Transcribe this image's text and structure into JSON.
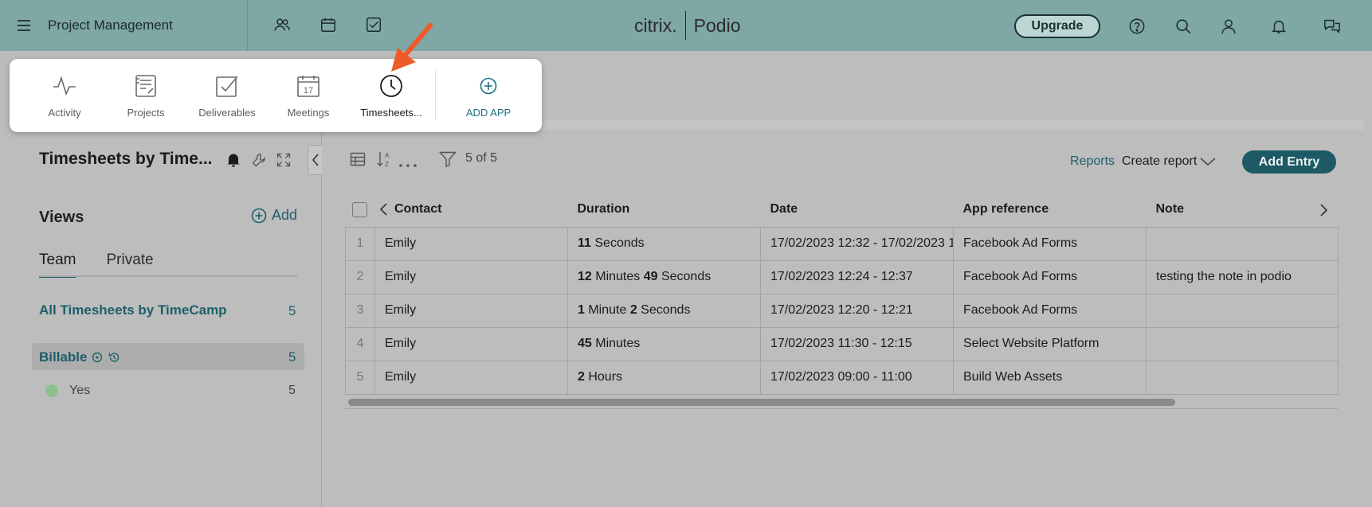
{
  "header": {
    "workspace": "Project Management",
    "brand_citrix": "citrix.",
    "brand_podio": "Podio",
    "upgrade_label": "Upgrade"
  },
  "dropdown": {
    "items": [
      {
        "label": "Activity",
        "icon": "activity-icon"
      },
      {
        "label": "Projects",
        "icon": "projects-icon"
      },
      {
        "label": "Deliverables",
        "icon": "deliverables-icon"
      },
      {
        "label": "Meetings",
        "icon": "meetings-icon",
        "icon_text": "17"
      },
      {
        "label": "Timesheets...",
        "icon": "clock-icon"
      }
    ],
    "add_app_label": "ADD APP"
  },
  "app": {
    "title": "Timesheets by Time..."
  },
  "views": {
    "heading": "Views",
    "add_label": "Add",
    "tabs": [
      "Team",
      "Private"
    ],
    "all_label": "All Timesheets by TimeCamp",
    "all_count": "5",
    "billable_label": "Billable",
    "billable_count": "5",
    "yes_label": "Yes",
    "yes_count": "5"
  },
  "toolbar": {
    "filter_count": "5 of 5",
    "reports_label": "Reports",
    "create_report_label": "Create report",
    "add_entry_label": "Add Entry"
  },
  "table": {
    "columns": [
      "Contact",
      "Duration",
      "Date",
      "App reference",
      "Note"
    ],
    "rows": [
      {
        "num": "1",
        "contact": "Emily",
        "duration": [
          {
            "b": "11"
          },
          {
            "t": " Seconds"
          }
        ],
        "date": "17/02/2023 12:32 - 17/02/2023 1",
        "app_ref": "Facebook Ad Forms",
        "note": ""
      },
      {
        "num": "2",
        "contact": "Emily",
        "duration": [
          {
            "b": "12"
          },
          {
            "t": " Minutes "
          },
          {
            "b": "49"
          },
          {
            "t": " Seconds"
          }
        ],
        "date": "17/02/2023 12:24 - 12:37",
        "app_ref": "Facebook Ad Forms",
        "note": "testing the note in podio"
      },
      {
        "num": "3",
        "contact": "Emily",
        "duration": [
          {
            "b": "1"
          },
          {
            "t": " Minute "
          },
          {
            "b": "2"
          },
          {
            "t": " Seconds"
          }
        ],
        "date": "17/02/2023 12:20 - 12:21",
        "app_ref": "Facebook Ad Forms",
        "note": ""
      },
      {
        "num": "4",
        "contact": "Emily",
        "duration": [
          {
            "b": "45"
          },
          {
            "t": " Minutes"
          }
        ],
        "date": "17/02/2023 11:30 - 12:15",
        "app_ref": "Select Website Platform",
        "note": ""
      },
      {
        "num": "5",
        "contact": "Emily",
        "duration": [
          {
            "b": "2"
          },
          {
            "t": " Hours"
          }
        ],
        "date": "17/02/2023 09:00 - 11:00",
        "app_ref": "Build Web Assets",
        "note": ""
      }
    ]
  },
  "colors": {
    "topbar": "#7ea7a5",
    "accent": "#1d5f6a",
    "arrow": "#f05a28"
  }
}
